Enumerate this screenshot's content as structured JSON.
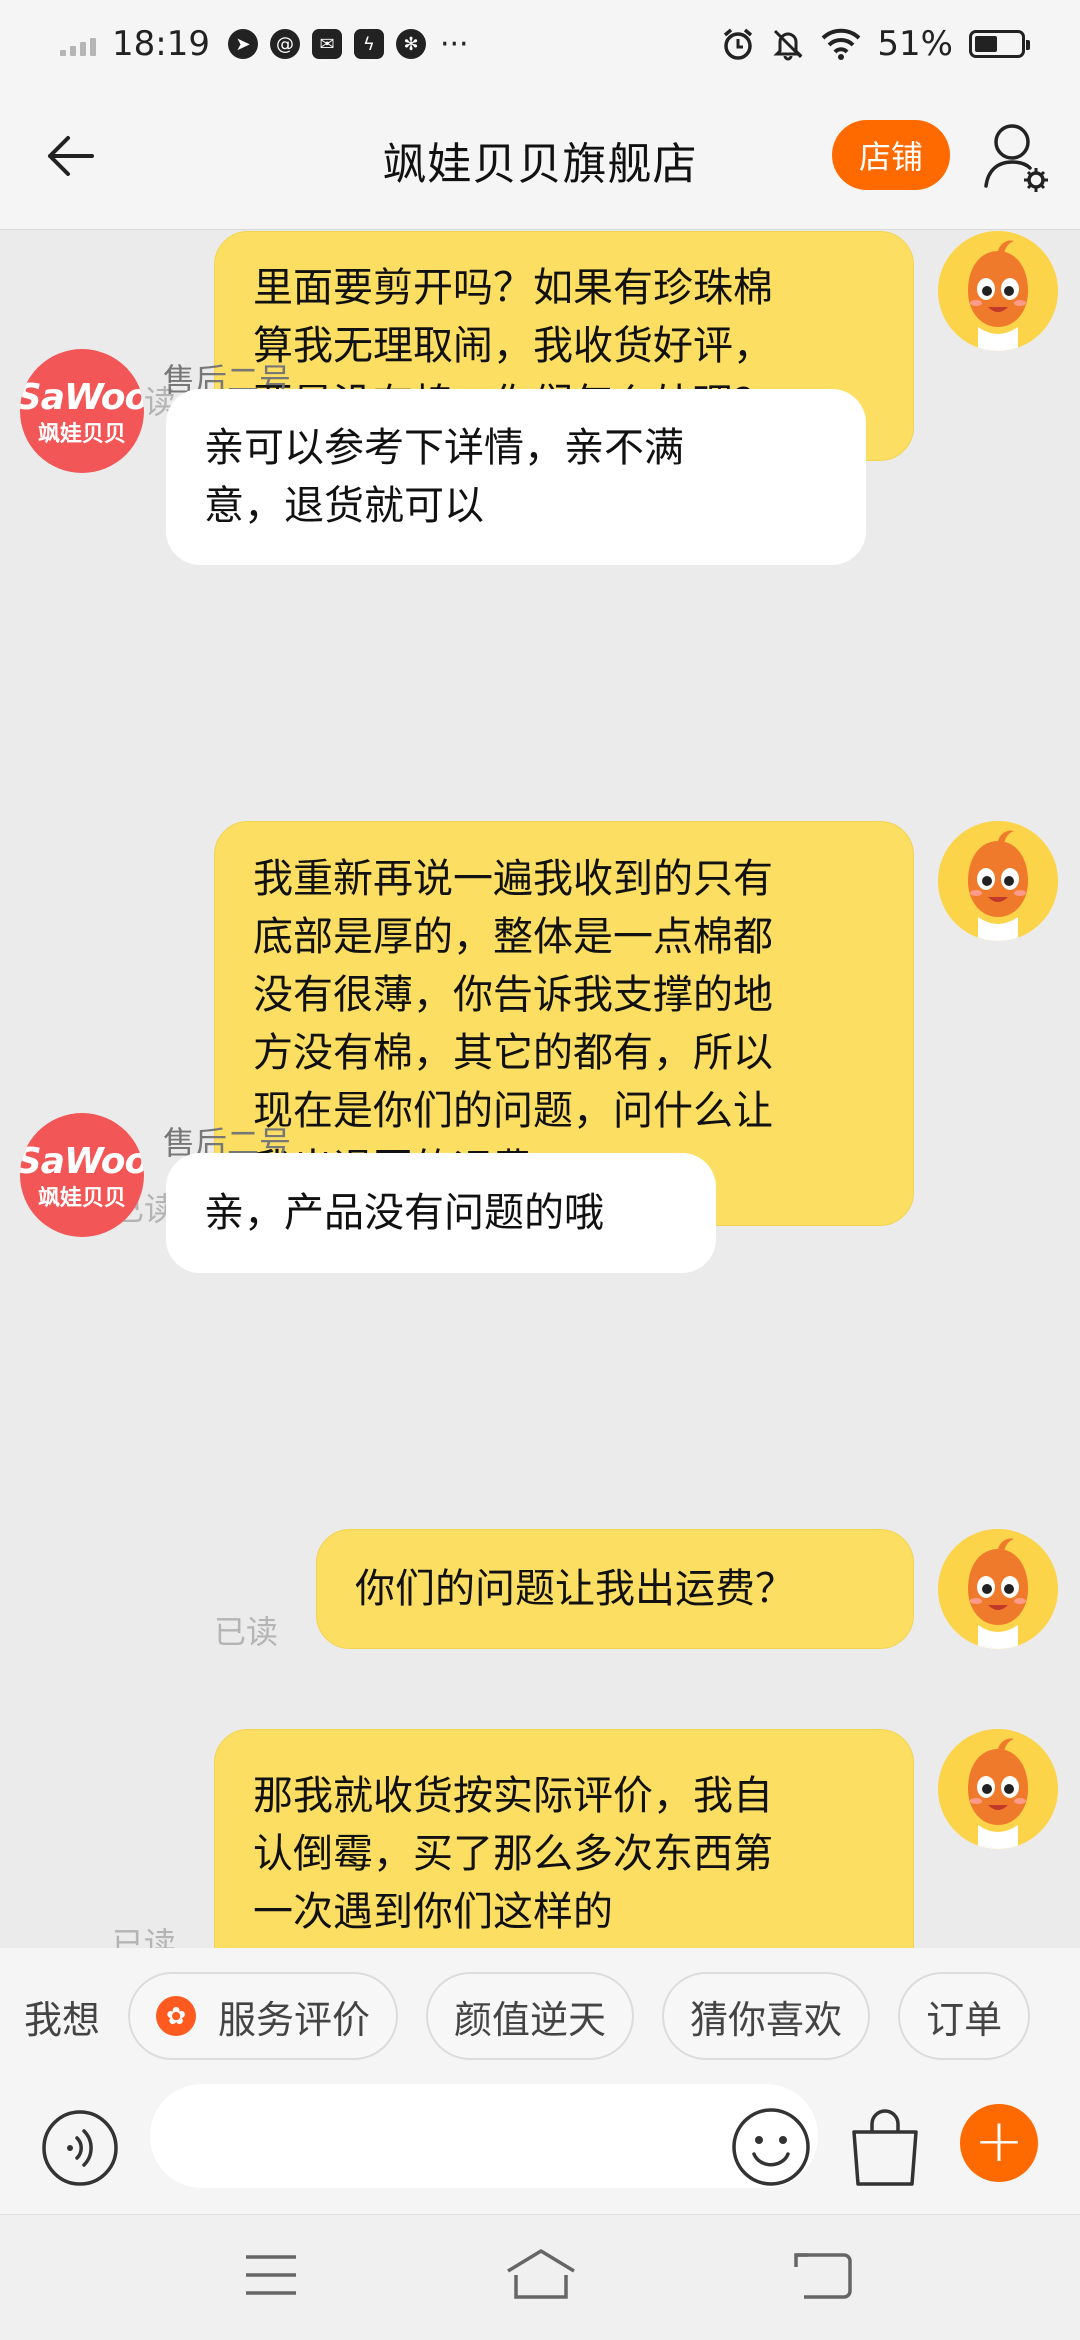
{
  "status_bar": {
    "time": "18:19",
    "notification_icons": [
      "navigation-icon",
      "at-icon",
      "mail-icon",
      "flash-icon",
      "pinwheel-icon"
    ],
    "more": "···",
    "battery": "51%",
    "battery_level": 0.51
  },
  "header": {
    "title": "飒娃贝贝旗舰店",
    "store_label": "店铺"
  },
  "messages": [
    {
      "from": "me",
      "lines": [
        "里面要剪开吗？如果有珍珠棉",
        "算我无理取闹，我收货好评，",
        "要是没有棉，你们怎么处理？"
      ],
      "read": "已读"
    },
    {
      "from": "shop",
      "sender": "售后二号",
      "lines": [
        "亲可以参考下详情，亲不满",
        "意，退货就可以"
      ]
    },
    {
      "from": "me",
      "lines": [
        "我重新再说一遍我收到的只有",
        "底部是厚的，整体是一点棉都",
        "没有很薄，你告诉我支撑的地",
        "方没有棉，其它的都有，所以",
        "现在是你们的问题，问什么让",
        "我出退回的运费"
      ],
      "read": "已读"
    },
    {
      "from": "shop",
      "sender": "售后二号",
      "lines": [
        "亲，产品没有问题的哦"
      ]
    },
    {
      "from": "me",
      "lines": [
        "你们的问题让我出运费？"
      ],
      "read": "已读"
    },
    {
      "from": "me",
      "lines": [
        "那我就收货按实际评价，我自",
        "认倒霉，买了那么多次东西第",
        "一次遇到你们这样的"
      ],
      "read": "已读"
    }
  ],
  "shop_avatar": {
    "brand": "SaWoo",
    "name_cn": "飒娃贝贝"
  },
  "quick_replies": {
    "label": "我想",
    "chips": [
      "服务评价",
      "颜值逆天",
      "猜你喜欢",
      "订单"
    ]
  },
  "input": {
    "value": "",
    "placeholder": ""
  },
  "colors": {
    "accent": "#ff6a00",
    "my_bubble": "#fcdf62",
    "their_bubble": "#ffffff",
    "chat_background": "#ebebeb"
  }
}
